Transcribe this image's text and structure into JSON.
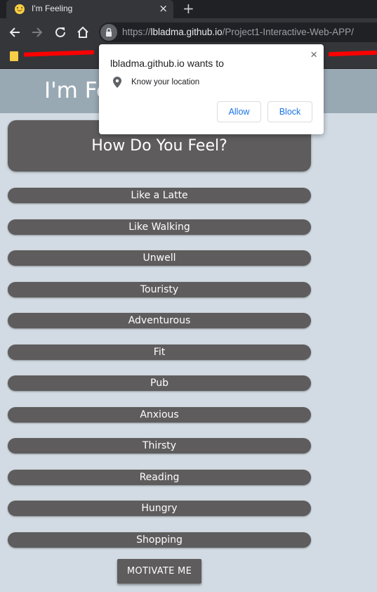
{
  "browser": {
    "tab_title": "I'm Feeling",
    "tab_close": "×",
    "new_tab": "+",
    "url_scheme": "https://",
    "url_host": "lbladma.github.io",
    "url_path": "/Project1-Interactive-Web-APP/"
  },
  "permission_prompt": {
    "title": "lbladma.github.io wants to",
    "item": "Know your location",
    "close": "×",
    "allow_label": "Allow",
    "block_label": "Block"
  },
  "page": {
    "title": "I'm Feeling",
    "question": "How Do You Feel?",
    "moods": [
      "Like a Latte",
      "Like Walking",
      "Unwell",
      "Touristy",
      "Adventurous",
      "Fit",
      "Pub",
      "Anxious",
      "Thirsty",
      "Reading",
      "Hungry",
      "Shopping"
    ],
    "motivate_label": "MOTIVATE ME"
  },
  "colors": {
    "page_background": "#d2dbe3",
    "header_background": "#99a9b4",
    "button_background": "#5e5c5c",
    "link_blue": "#1a73e8"
  }
}
